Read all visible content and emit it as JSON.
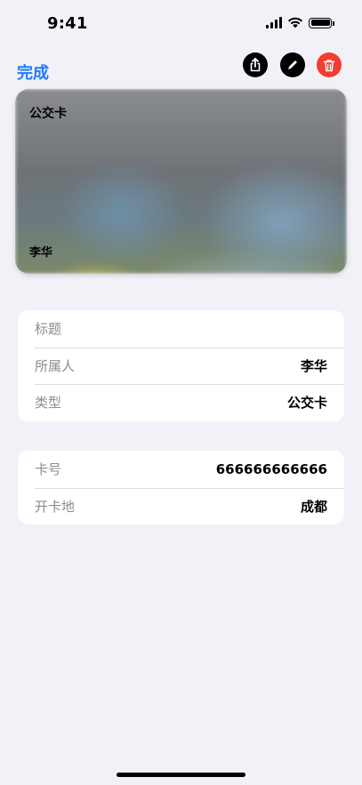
{
  "status_bar": {
    "time": "9:41"
  },
  "nav": {
    "done_label": "完成",
    "actions": [
      "share-icon",
      "pencil-icon",
      "trash-icon"
    ],
    "action_colors": {
      "share": "#000000",
      "edit": "#000000",
      "delete": "#f23d2f"
    }
  },
  "card": {
    "title": "公交卡",
    "owner": "李华"
  },
  "details": {
    "rows": [
      {
        "label": "标题",
        "value": ""
      },
      {
        "label": "所属人",
        "value": "李华"
      },
      {
        "label": "类型",
        "value": "公交卡"
      }
    ]
  },
  "extra": {
    "rows": [
      {
        "label": "卡号",
        "value": "666666666666"
      },
      {
        "label": "开卡地",
        "value": "成都"
      }
    ]
  },
  "colors": {
    "accent": "#1f7bff",
    "background": "#f2f1f7"
  }
}
